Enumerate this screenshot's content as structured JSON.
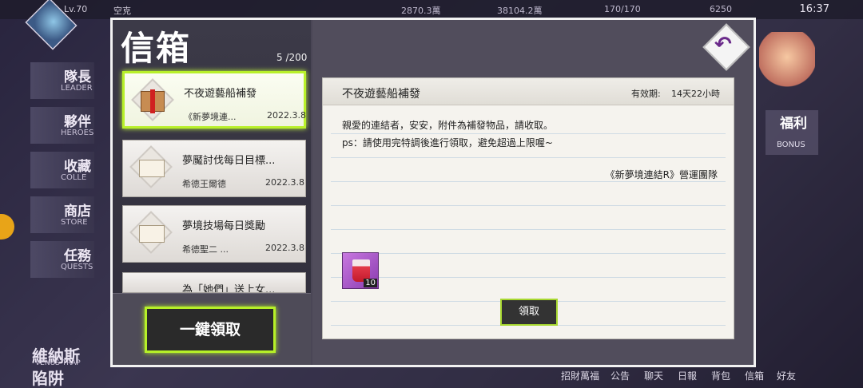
{
  "status_bar": {
    "level": "Lv.70",
    "player_name": "空克",
    "resource_1": "2870.3萬",
    "resource_2": "38104.2萬",
    "stamina": "170/170",
    "resource_4": "6250",
    "clock": "16:37"
  },
  "left_nav": [
    {
      "cn": "隊長",
      "en": "LEADER"
    },
    {
      "cn": "夥伴",
      "en": "HEROES"
    },
    {
      "cn": "收藏",
      "en": "COLLE"
    },
    {
      "cn": "商店",
      "en": "STORE"
    },
    {
      "cn": "任務",
      "en": "QUESTS"
    }
  ],
  "bg_event": {
    "line1": "維納斯",
    "en": "VENUS TRAP",
    "line2": "陷阱"
  },
  "bonus": {
    "cn": "福利",
    "en": "BONUS"
  },
  "bottom_nav": [
    "招財萬福",
    "公告",
    "聊天",
    "日報",
    "背包",
    "信箱",
    "好友"
  ],
  "mailbox": {
    "title": "信箱",
    "count": "5 /200",
    "mails": [
      {
        "title": "不夜遊藝船補發",
        "sender": "《新夢境連...",
        "date": "2022.3.8",
        "icon": "gift-box-icon",
        "selected": true
      },
      {
        "title": "夢魘討伐每日目標...",
        "sender": "希德王爾德",
        "date": "2022.3.8",
        "icon": "envelope-icon",
        "selected": false
      },
      {
        "title": "夢境技場每日獎勵",
        "sender": "希德聖二 ...",
        "date": "2022.3.8",
        "icon": "envelope-icon",
        "selected": false
      },
      {
        "title": "為「她們」送上女...",
        "sender": "",
        "date": "",
        "icon": "envelope-icon",
        "selected": false
      }
    ],
    "claim_all_label": "一鍵領取"
  },
  "detail": {
    "title": "不夜遊藝船補發",
    "validity_label": "有效期:",
    "validity_value": "14天22小時",
    "body_line1": "親愛的連結者，安安，附件為補發物品，請收取。",
    "body_line2": "ps：請使用完特調後進行領取，避免超過上限喔~",
    "signature": "《新夢境連結R》營運團隊",
    "attachment": {
      "icon": "drink-cup-icon",
      "qty": "10"
    },
    "claim_label": "領取"
  },
  "colors": {
    "accent_green": "#b6f028",
    "panel": "#4a4656",
    "paper": "#f5f3ee"
  }
}
